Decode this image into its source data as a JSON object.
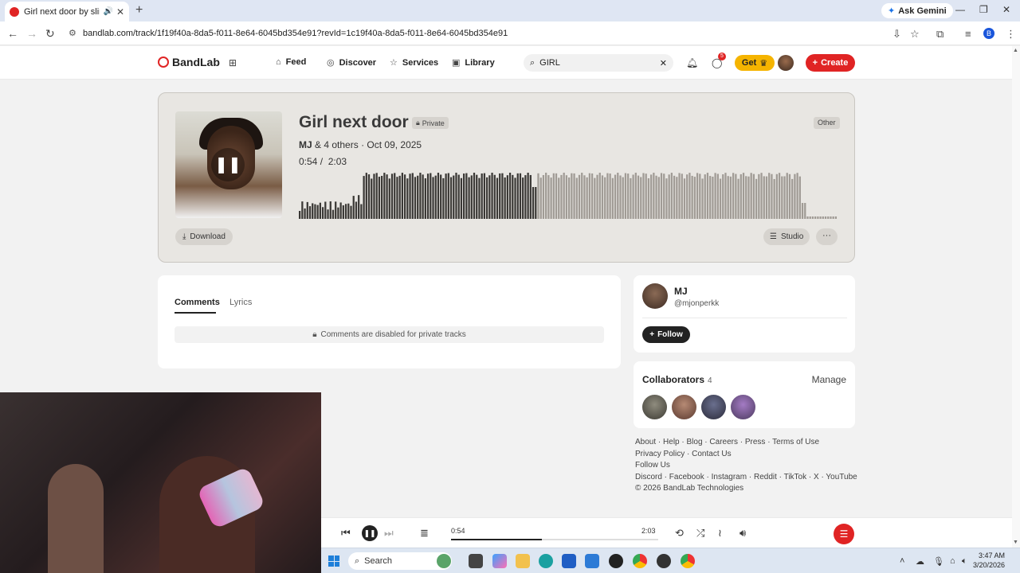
{
  "browser": {
    "tab_title": "Girl next door by slimeyboy",
    "url": "bandlab.com/track/1f19f40a-8da5-f011-8e64-6045bd354e91?revId=1c19f40a-8da5-f011-8e64-6045bd354e91",
    "ask_gemini": "Ask Gemini",
    "profile_initial": "B"
  },
  "header": {
    "logo": "BandLab",
    "nav": [
      {
        "label": "Feed",
        "icon": "home-icon"
      },
      {
        "label": "Discover",
        "icon": "compass-icon"
      },
      {
        "label": "Services",
        "icon": "star-icon"
      },
      {
        "label": "Library",
        "icon": "library-icon"
      }
    ],
    "search_value": "GIRL",
    "notifications_badge": "5",
    "get_label": "Get",
    "create_label": "Create"
  },
  "track": {
    "title": "Girl next door",
    "private_label": "Private",
    "artist": "MJ",
    "others": "& 4 others",
    "date": "· Oct 09, 2025",
    "elapsed": "0:54",
    "duration": "2:03",
    "genre_tag": "Other",
    "download_label": "Download",
    "studio_label": "Studio",
    "more_label": "···",
    "progress_fraction": 0.44
  },
  "comments": {
    "tabs": [
      "Comments",
      "Lyrics"
    ],
    "disabled_text": "Comments are disabled for private tracks"
  },
  "profile": {
    "name": "MJ",
    "handle": "@mjonperkk",
    "follow_label": "Follow"
  },
  "collaborators": {
    "title": "Collaborators",
    "count": "4",
    "manage_label": "Manage"
  },
  "footer": {
    "row1": [
      "About",
      "Help",
      "Blog",
      "Careers",
      "Press",
      "Terms of Use"
    ],
    "row2": [
      "Privacy Policy",
      "Contact Us"
    ],
    "follow_us": "Follow Us",
    "social": [
      "Discord",
      "Facebook",
      "Instagram",
      "Reddit",
      "TikTok",
      "X",
      "YouTube"
    ],
    "copyright": "© 2026 BandLab Technologies"
  },
  "player": {
    "elapsed": "0:54",
    "duration": "2:03",
    "progress_fraction": 0.44
  },
  "taskbar": {
    "search_label": "Search",
    "time": "3:47 AM",
    "date": "3/20/2026"
  },
  "colors": {
    "accent": "#e02424",
    "gold": "#f5b400"
  }
}
